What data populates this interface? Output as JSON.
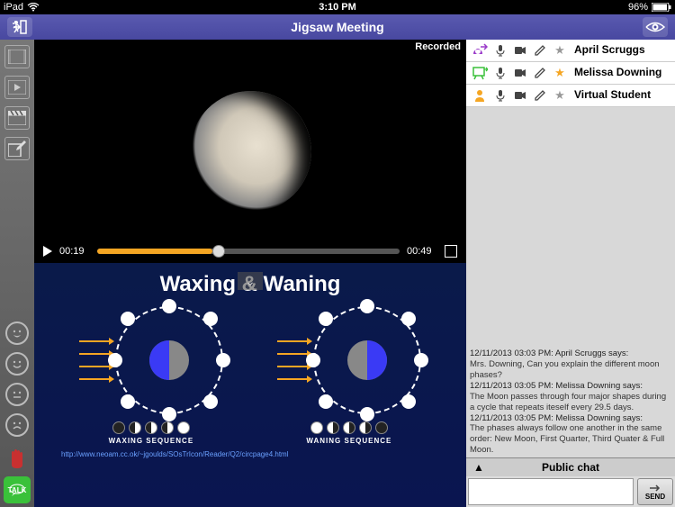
{
  "status": {
    "carrier": "iPad",
    "time": "3:10 PM",
    "battery": "96%"
  },
  "header": {
    "title": "Jigsaw Meeting"
  },
  "video": {
    "recorded_label": "Recorded",
    "current_time": "00:19",
    "duration": "00:49"
  },
  "slide": {
    "title": "Waxing & Waning",
    "seq_waxing": "WAXING SEQUENCE",
    "seq_waning": "WANING SEQUENCE",
    "link": "http://www.neoam.cc.ok/~jgoulds/SOsTrIcon/Reader/Q2/circpage4.html"
  },
  "participants": [
    {
      "name": "April Scruggs",
      "role_color": "#9a3ac9",
      "star": "gray"
    },
    {
      "name": "Melissa Downing",
      "role_color": "#3ac13a",
      "star": "gold"
    },
    {
      "name": "Virtual Student",
      "role_color": "#f5a623",
      "star": "gray"
    }
  ],
  "chat": {
    "title": "Public chat",
    "send_label": "SEND",
    "messages": [
      {
        "meta": "12/11/2013 03:03 PM: April Scruggs says:",
        "text": "Mrs. Downing, Can you explain the different moon phases?"
      },
      {
        "meta": "12/11/2013 03:05 PM: Melissa Downing says:",
        "text": "The Moon passes through four major shapes during a cycle that repeats iteself every 29.5 days."
      },
      {
        "meta": "12/11/2013 03:05 PM: Melissa Downing says:",
        "text": "The phases always follow one another in the same order: New Moon, First Quarter, Third Quater & Full Moon."
      }
    ]
  },
  "rail": {
    "talk": "TALK"
  }
}
